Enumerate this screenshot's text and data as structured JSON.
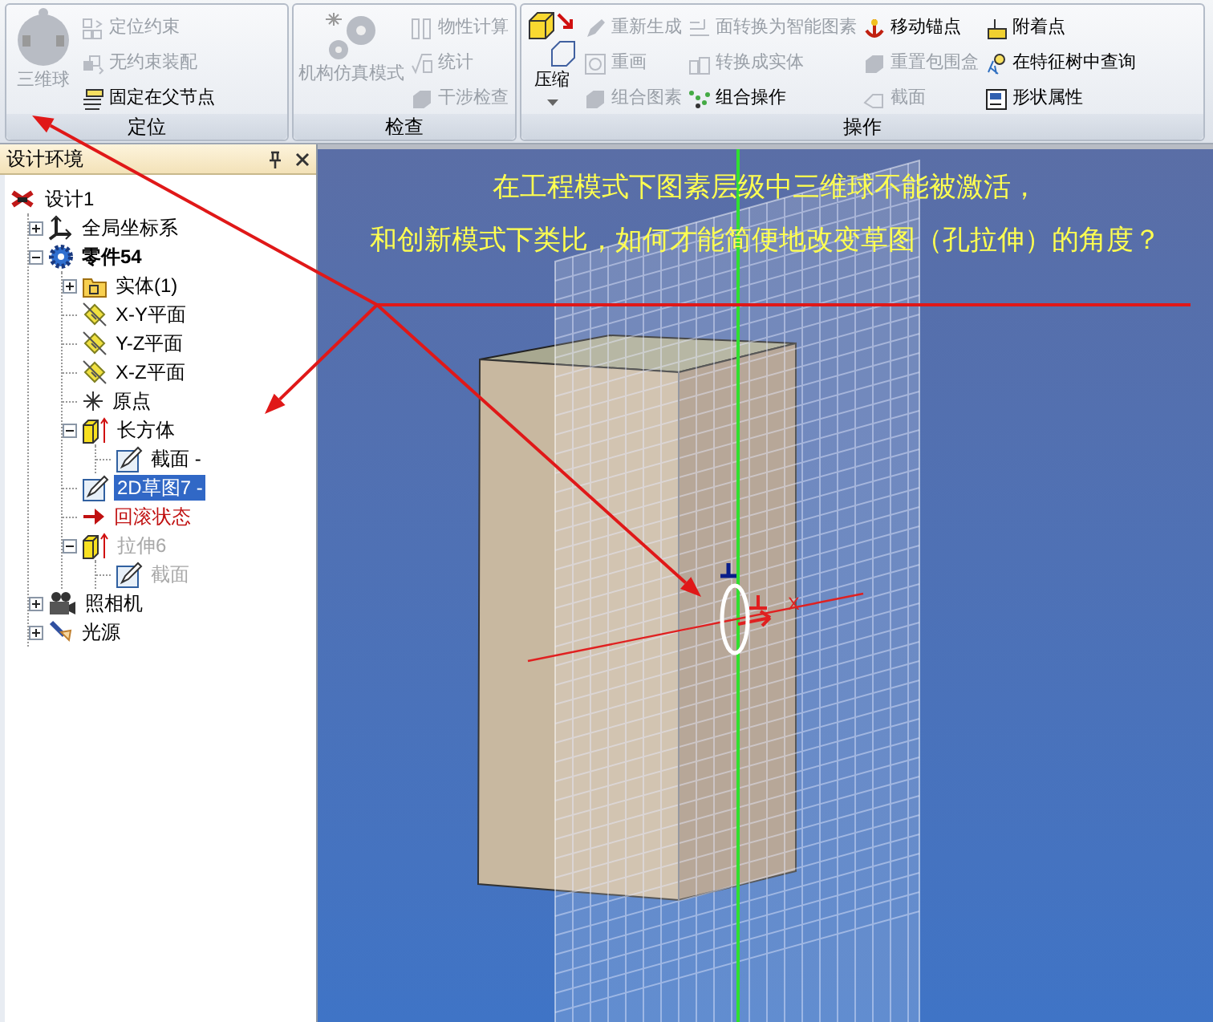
{
  "ribbon": {
    "groups": [
      {
        "caption": "定位",
        "large": {
          "label": "三维球",
          "disabled": true
        },
        "columns": [
          [
            {
              "label": "定位约束",
              "disabled": true
            },
            {
              "label": "无约束装配",
              "disabled": true
            },
            {
              "label": "固定在父节点",
              "disabled": false
            }
          ]
        ]
      },
      {
        "caption": "检查",
        "large": {
          "label": "机构仿真模式",
          "disabled": true
        },
        "columns": [
          [
            {
              "label": "物性计算",
              "disabled": true
            },
            {
              "label": "统计",
              "disabled": true
            },
            {
              "label": "干涉检查",
              "disabled": true
            }
          ]
        ]
      },
      {
        "caption": "操作",
        "large": {
          "label": "压缩",
          "disabled": false
        },
        "columns": [
          [
            {
              "label": "重新生成",
              "disabled": true
            },
            {
              "label": "重画",
              "disabled": true
            },
            {
              "label": "组合图素",
              "disabled": true
            }
          ],
          [
            {
              "label": "面转换为智能图素",
              "disabled": true
            },
            {
              "label": "转换成实体",
              "disabled": true
            },
            {
              "label": "组合操作",
              "disabled": false
            }
          ],
          [
            {
              "label": "移动锚点",
              "disabled": false
            },
            {
              "label": "重置包围盒",
              "disabled": true
            },
            {
              "label": "截面",
              "disabled": true
            }
          ],
          [
            {
              "label": "附着点",
              "disabled": false
            },
            {
              "label": "在特征树中查询",
              "disabled": false
            },
            {
              "label": "形状属性",
              "disabled": false
            }
          ]
        ]
      }
    ]
  },
  "panel": {
    "title": "设计环境"
  },
  "tree": {
    "label": "设计1",
    "kind": "design",
    "selected": false,
    "disabled": false,
    "children": [
      {
        "label": "全局坐标系",
        "kind": "axes",
        "expanded": false,
        "selected": false,
        "disabled": false
      },
      {
        "label": "零件54",
        "kind": "part",
        "expanded": true,
        "selected": false,
        "disabled": false,
        "children": [
          {
            "label": "实体(1)",
            "kind": "folder",
            "expanded": false,
            "selected": false,
            "disabled": false
          },
          {
            "label": "X-Y平面",
            "kind": "plane",
            "selected": false,
            "disabled": false
          },
          {
            "label": "Y-Z平面",
            "kind": "plane",
            "selected": false,
            "disabled": false
          },
          {
            "label": "X-Z平面",
            "kind": "plane",
            "selected": false,
            "disabled": false
          },
          {
            "label": "原点",
            "kind": "origin",
            "selected": false,
            "disabled": false
          },
          {
            "label": "长方体",
            "kind": "feature",
            "expanded": true,
            "selected": false,
            "disabled": false,
            "children": [
              {
                "label": "截面 -",
                "kind": "sketch",
                "selected": false,
                "disabled": false
              }
            ]
          },
          {
            "label": "2D草图7 -",
            "kind": "sketch",
            "selected": true,
            "disabled": false
          },
          {
            "label": "回滚状态",
            "kind": "rollback",
            "selected": false,
            "disabled": false
          },
          {
            "label": "拉伸6",
            "kind": "feature",
            "expanded": true,
            "selected": false,
            "disabled": true,
            "children": [
              {
                "label": "截面",
                "kind": "sketch",
                "selected": false,
                "disabled": true
              }
            ]
          }
        ]
      },
      {
        "label": "照相机",
        "kind": "camera",
        "expanded": false,
        "selected": false,
        "disabled": false
      },
      {
        "label": "光源",
        "kind": "light",
        "expanded": false,
        "selected": false,
        "disabled": false
      }
    ]
  },
  "viewport": {
    "annotation_lines": [
      "在工程模式下图素层级中三维球不能被激活，",
      "和创新模式下类比，如何才能简便地改变草图（孔拉伸）的角度？"
    ],
    "axis_label": "X"
  }
}
